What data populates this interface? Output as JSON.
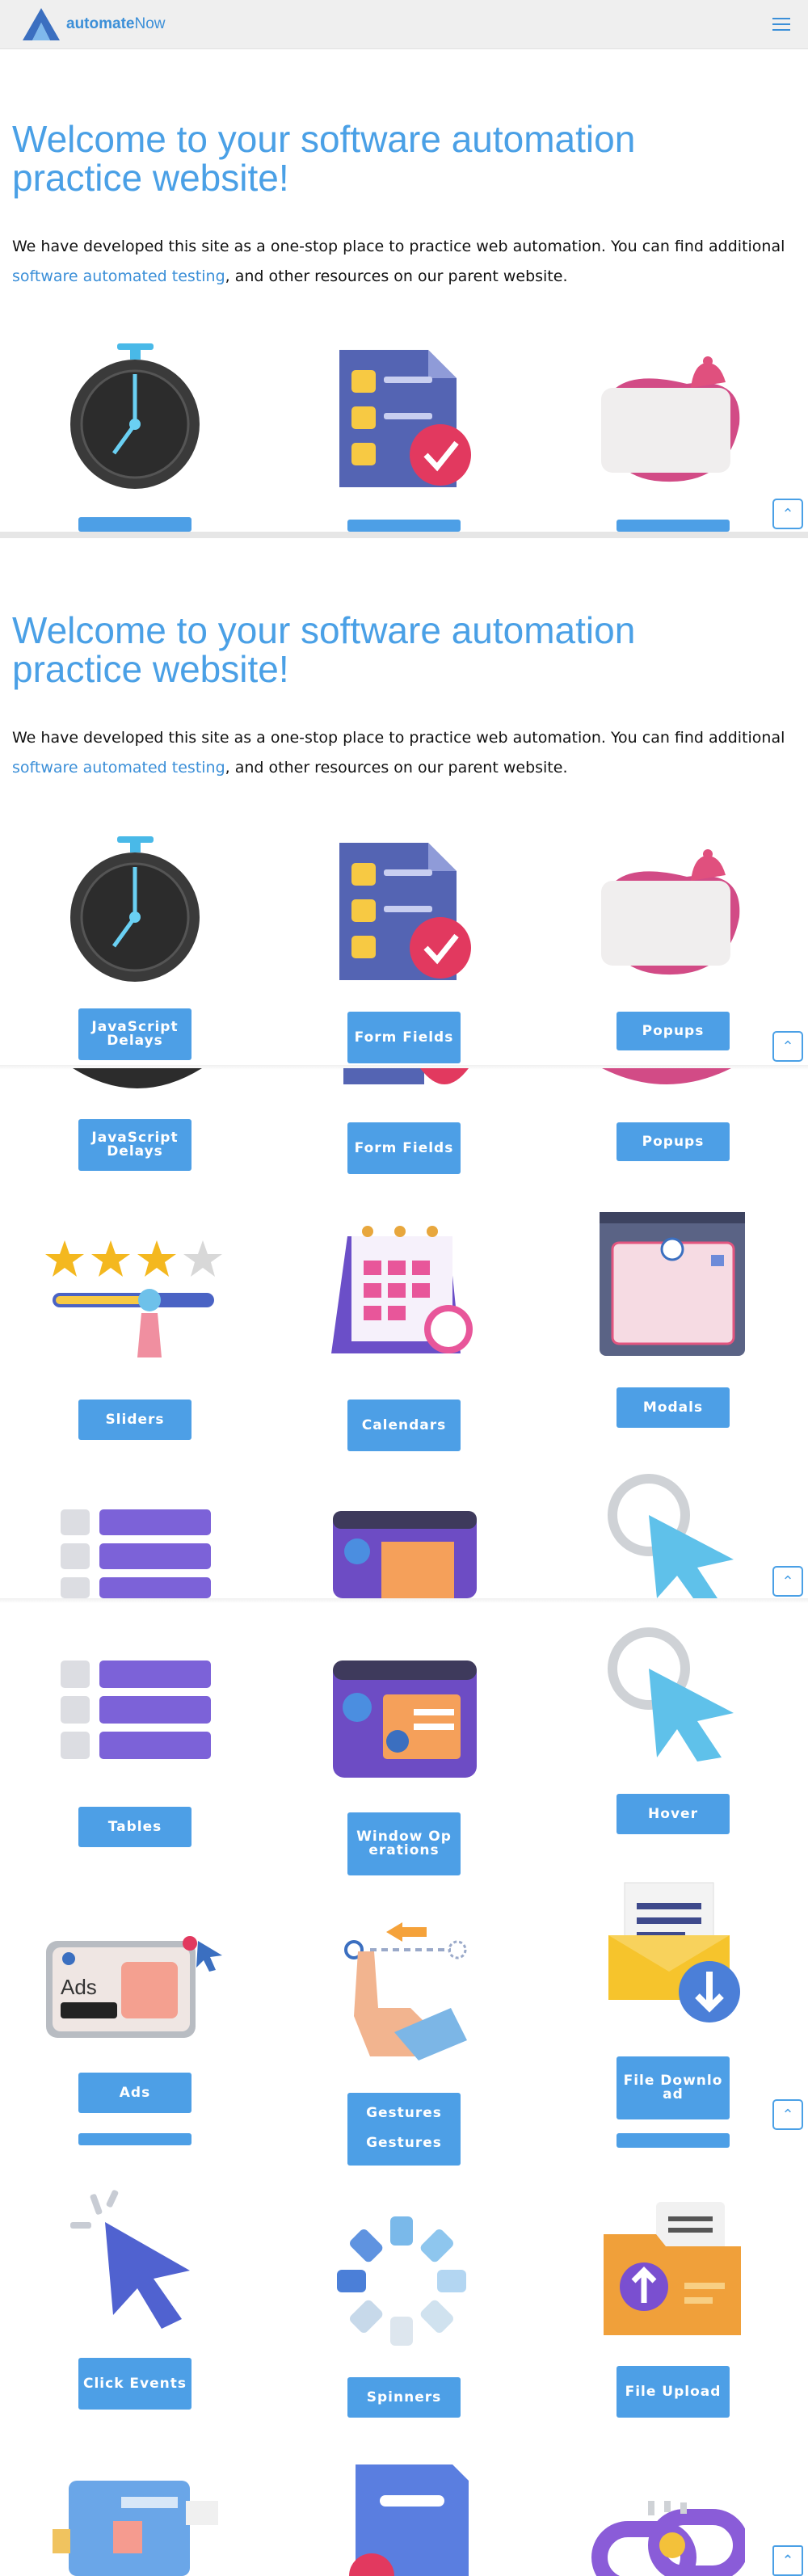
{
  "header": {
    "logo_bold": "automate",
    "logo_rest": "Now",
    "menu_icon": "hamburger-icon"
  },
  "hero": {
    "title": "Welcome to your software automation practice website!",
    "text_before": "We have developed this site as a one-stop place to practice web automation. You can find additional ",
    "link_text": "software automated testing",
    "text_after": ", and other resources on our parent website."
  },
  "cards": {
    "js_delays": "JavaScript Delays",
    "form_fields": "Form Fields",
    "popups": "Popups",
    "sliders": "Sliders",
    "calendars": "Calendars",
    "modals": "Modals",
    "tables": "Tables",
    "window_operations": "Window Operations",
    "hover": "Hover",
    "ads": "Ads",
    "gestures": "Gestures",
    "file_download": "File Download",
    "click_events": "Click Events",
    "spinners": "Spinners",
    "file_upload": "File Upload"
  },
  "scroll_top_icon": "chevron-up-icon",
  "colors": {
    "accent": "#4d9fe6",
    "title": "#4aa0e6",
    "header_bg": "#efefef"
  }
}
